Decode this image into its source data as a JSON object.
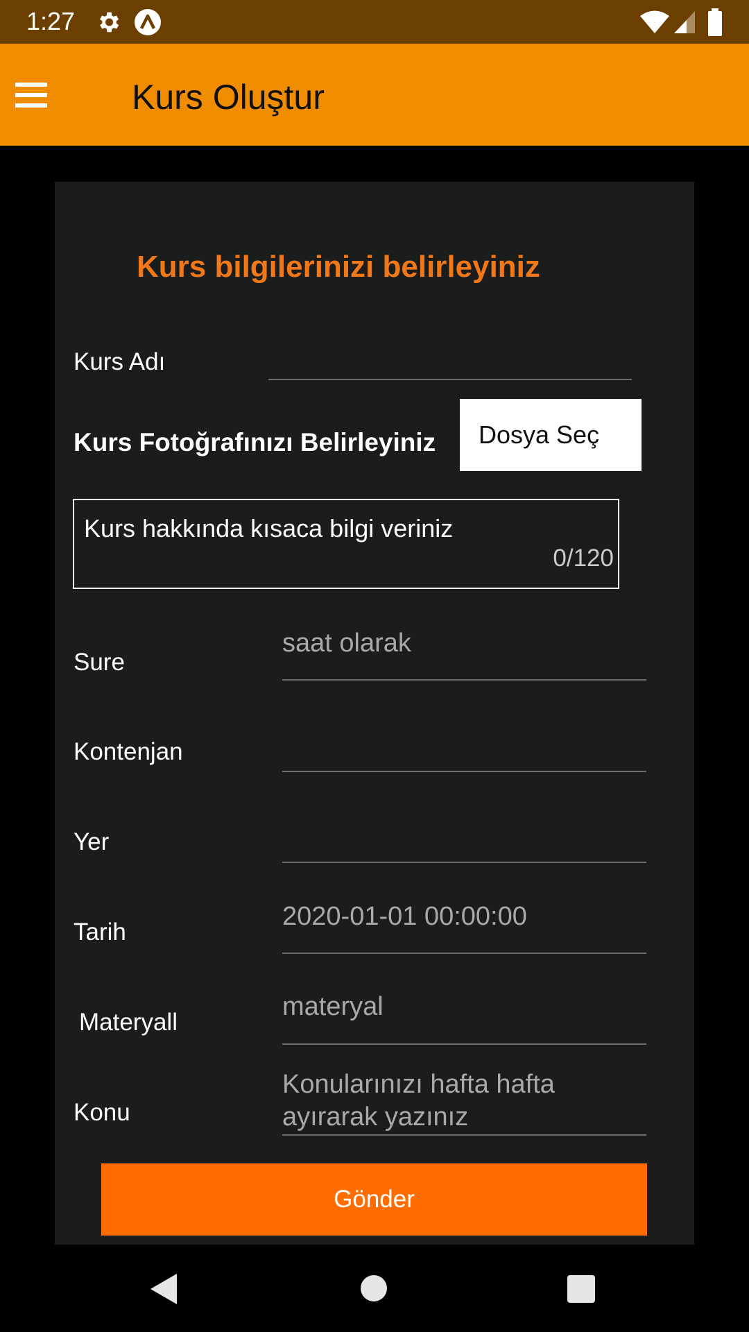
{
  "status_bar": {
    "time": "1:27",
    "icons": [
      "gear-icon",
      "a-logo-icon",
      "wifi-icon",
      "signal-icon",
      "battery-icon"
    ]
  },
  "app_bar": {
    "title": "Kurs Oluştur",
    "background": "#f08c00",
    "menu_icon": "hamburger-menu-icon"
  },
  "form": {
    "heading": "Kurs bilgilerinizi belirleyiniz",
    "heading_color": "#f07818",
    "course_name": {
      "label": "Kurs Adı",
      "value": ""
    },
    "photo": {
      "label": "Kurs Fotoğrafınızı Belirleyiniz",
      "button_label": "Dosya Seç"
    },
    "description": {
      "placeholder": "Kurs hakkında kısaca bilgi veriniz",
      "counter": "0/120"
    },
    "duration": {
      "label": "Sure",
      "placeholder": "saat olarak"
    },
    "capacity": {
      "label": "Kontenjan",
      "value": ""
    },
    "location": {
      "label": "Yer",
      "value": ""
    },
    "date": {
      "label": "Tarih",
      "placeholder": "2020-01-01 00:00:00"
    },
    "material": {
      "label": "Materyall",
      "placeholder": "materyal"
    },
    "topic": {
      "label": "Konu",
      "placeholder_line1": "Konularınızı hafta hafta",
      "placeholder_line2": "ayırarak yazınız"
    },
    "submit_label": "Gönder",
    "submit_color": "#ff6d00"
  },
  "nav_bar": {
    "icons": [
      "back-icon",
      "home-icon",
      "recent-apps-icon"
    ]
  }
}
